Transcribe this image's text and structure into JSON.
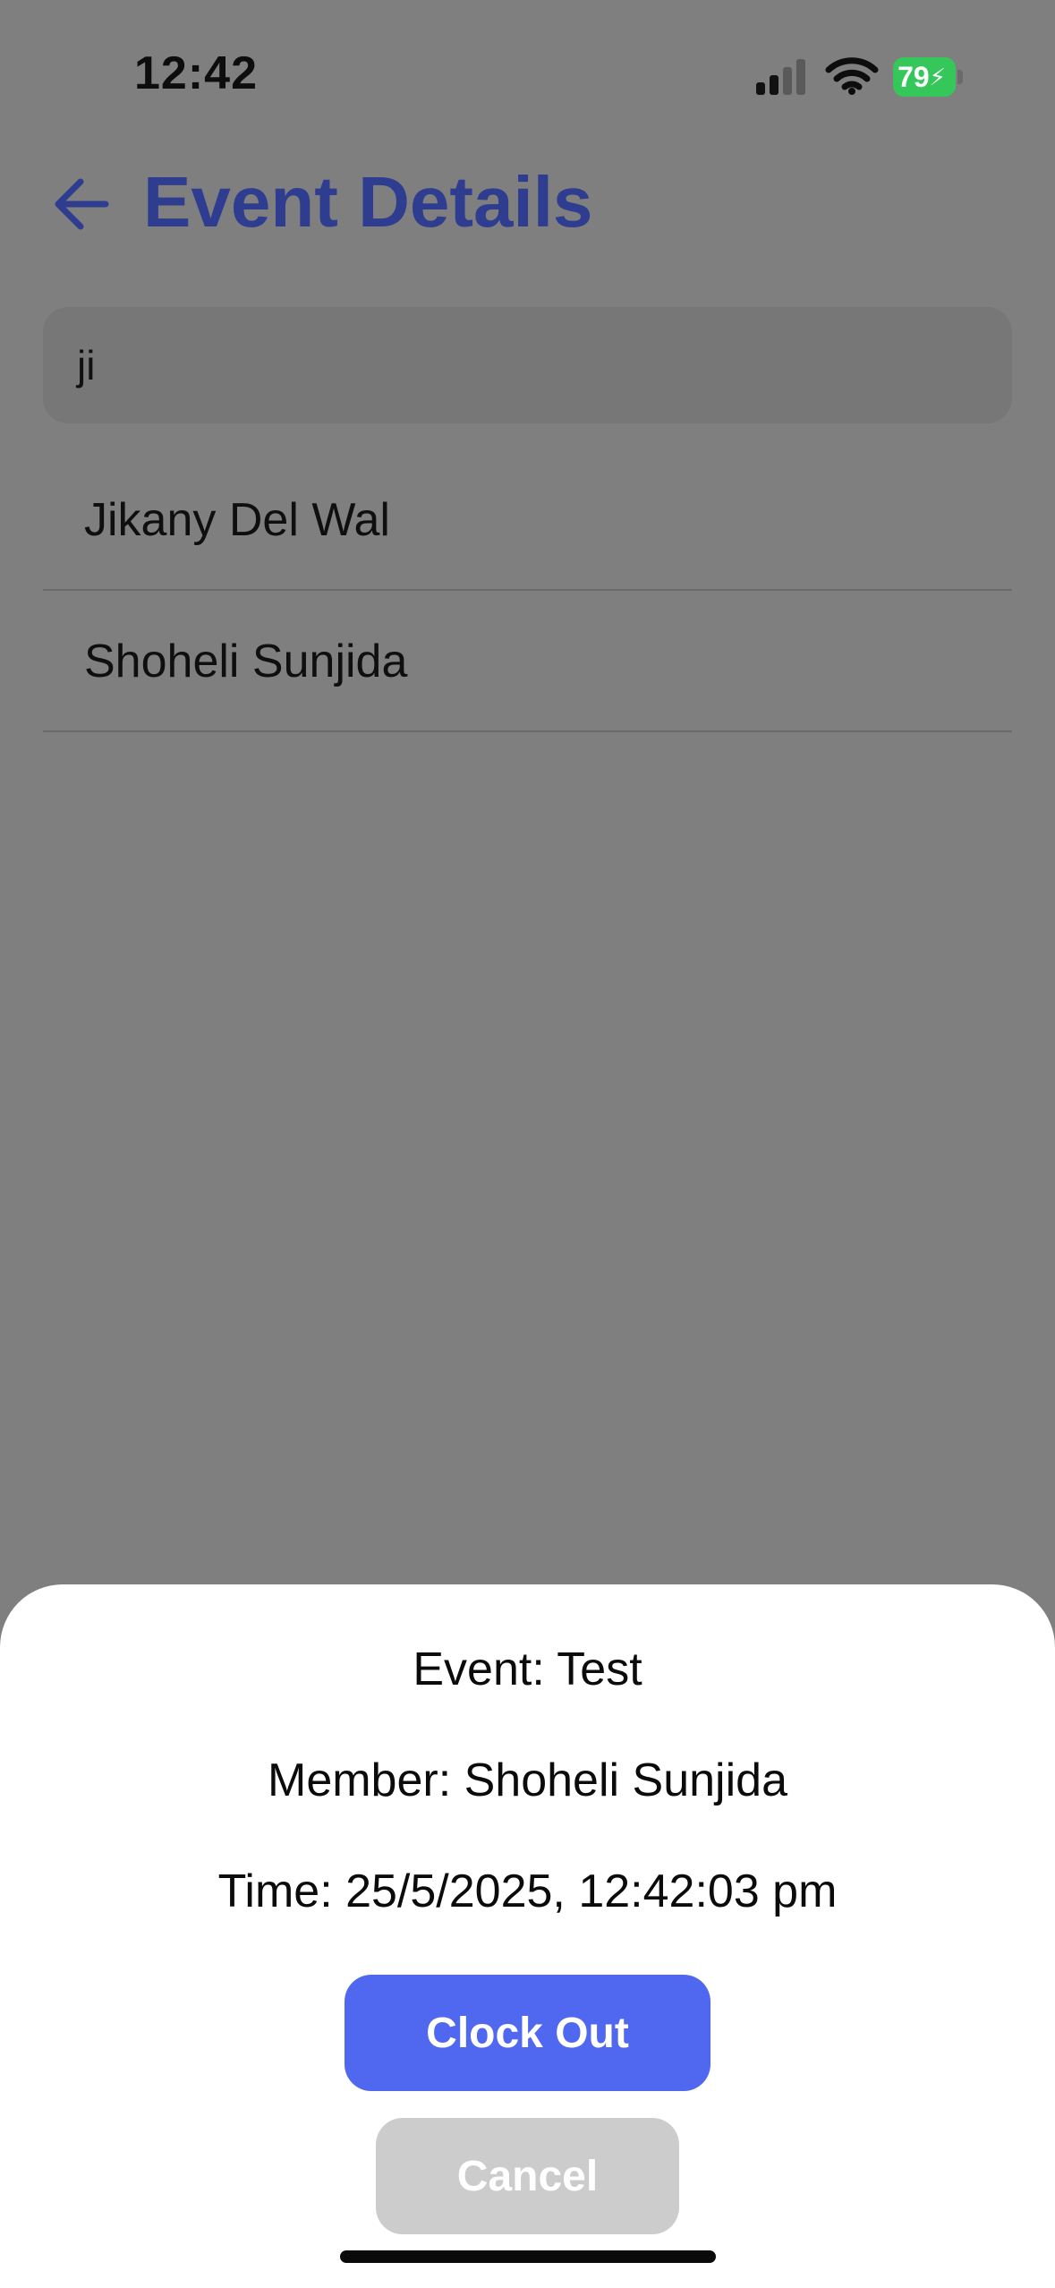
{
  "status_bar": {
    "time": "12:42",
    "battery_level": "79",
    "battery_color": "#35c759",
    "icons": [
      "cellular-signal-icon",
      "wifi-icon",
      "battery-charging-icon"
    ]
  },
  "header": {
    "back_icon": "arrow-left-icon",
    "title": "Event Details",
    "title_color": "#2e3d8f"
  },
  "search": {
    "value": "ji"
  },
  "results": [
    {
      "name": "Jikany Del Wal"
    },
    {
      "name": "Shoheli Sunjida"
    }
  ],
  "sheet": {
    "event_line": "Event: Test",
    "member_line": "Member: Shoheli Sunjida",
    "time_line": "Time: 25/5/2025, 12:42:03 pm",
    "clock_out_label": "Clock Out",
    "cancel_label": "Cancel",
    "clock_out_color": "#5068ef",
    "cancel_color": "#cccccc"
  }
}
